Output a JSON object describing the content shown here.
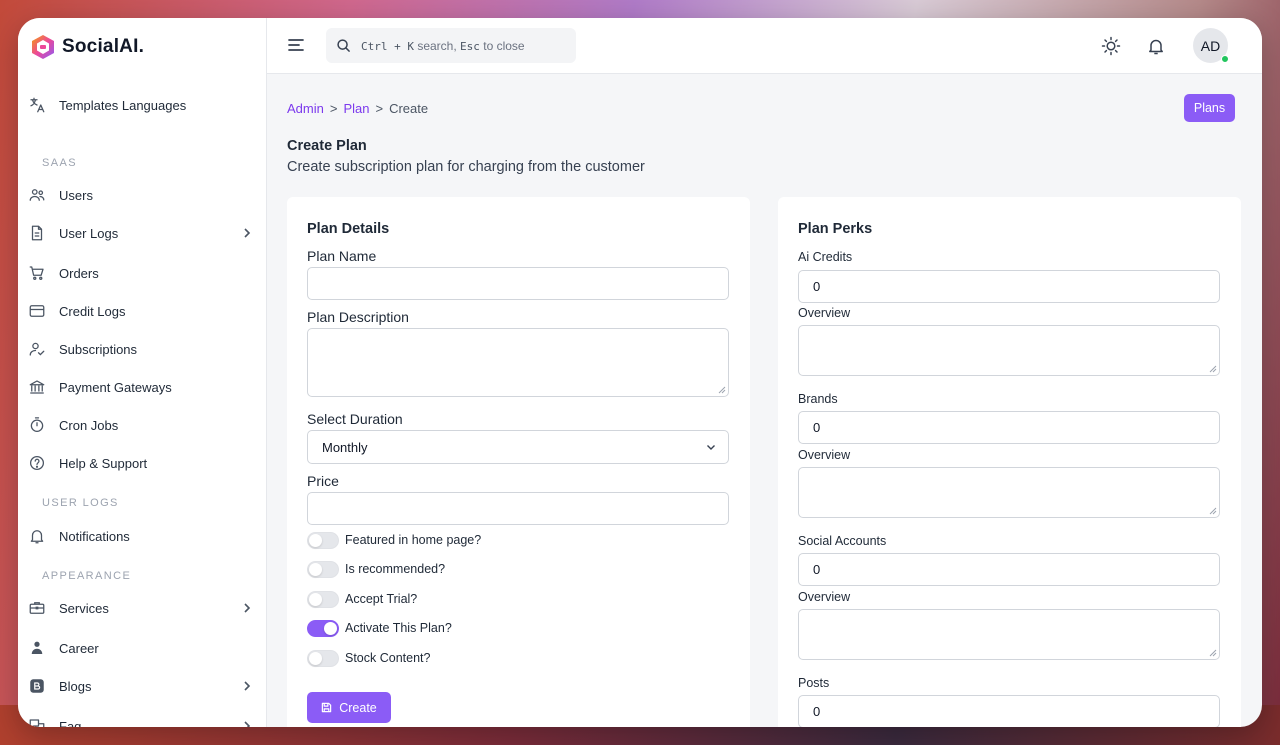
{
  "brand": {
    "name": "SocialAI.",
    "accent": "#8b5cf6"
  },
  "sidebar": {
    "items": [
      {
        "label": "Templates Languages",
        "icon": "translate-icon",
        "chevron": false
      },
      {
        "label": "Users",
        "icon": "users-icon",
        "chevron": false
      },
      {
        "label": "User Logs",
        "icon": "document-icon",
        "chevron": true
      },
      {
        "label": "Orders",
        "icon": "cart-icon",
        "chevron": false
      },
      {
        "label": "Credit Logs",
        "icon": "credit-card-icon",
        "chevron": false
      },
      {
        "label": "Subscriptions",
        "icon": "user-check-icon",
        "chevron": false
      },
      {
        "label": "Payment Gateways",
        "icon": "bank-icon",
        "chevron": false
      },
      {
        "label": "Cron Jobs",
        "icon": "timer-icon",
        "chevron": false
      },
      {
        "label": "Help & Support",
        "icon": "help-icon",
        "chevron": false
      },
      {
        "label": "Notifications",
        "icon": "bell-icon",
        "chevron": false
      },
      {
        "label": "Services",
        "icon": "briefcase-icon",
        "chevron": true
      },
      {
        "label": "Career",
        "icon": "career-icon",
        "chevron": false
      },
      {
        "label": "Blogs",
        "icon": "blog-icon",
        "chevron": true
      },
      {
        "label": "Faq",
        "icon": "faq-icon",
        "chevron": true
      }
    ],
    "sections": [
      "SAAS",
      "USER LOGS",
      "APPEARANCE"
    ]
  },
  "topbar": {
    "search_hint_kbd": "Ctrl + K",
    "search_hint_text": "search,",
    "search_hint_kbd2": "Esc",
    "search_hint_text2": "to close",
    "avatar_initials": "AD"
  },
  "breadcrumb": {
    "root": "Admin",
    "parent": "Plan",
    "current": "Create",
    "separator": ">"
  },
  "header": {
    "plans_button": "Plans",
    "title": "Create Plan",
    "subtitle": "Create subscription plan for charging from the customer"
  },
  "plan_details": {
    "title": "Plan Details",
    "name_label": "Plan Name",
    "name_value": "",
    "description_label": "Plan Description",
    "duration_label": "Select Duration",
    "duration_value": "Monthly",
    "price_label": "Price",
    "price_value": "",
    "toggles": [
      {
        "label": "Featured in home page?",
        "on": false
      },
      {
        "label": "Is recommended?",
        "on": false
      },
      {
        "label": "Accept Trial?",
        "on": false
      },
      {
        "label": "Activate This Plan?",
        "on": true
      },
      {
        "label": "Stock Content?",
        "on": false
      }
    ],
    "create_button": "Create"
  },
  "plan_perks": {
    "title": "Plan Perks",
    "overview_label": "Overview",
    "perks": [
      {
        "label": "Ai Credits",
        "value": "0"
      },
      {
        "label": "Brands",
        "value": "0"
      },
      {
        "label": "Social Accounts",
        "value": "0"
      },
      {
        "label": "Posts",
        "value": "0"
      }
    ]
  }
}
